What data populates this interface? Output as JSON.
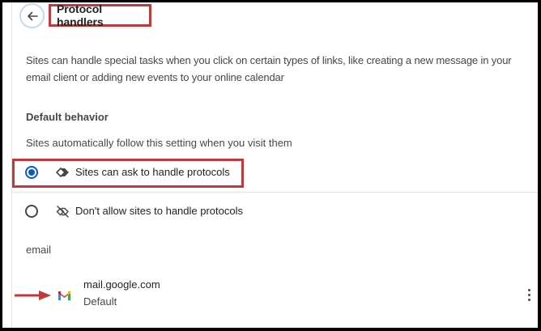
{
  "header": {
    "title": "Protocol handlers"
  },
  "description": "Sites can handle special tasks when you click on certain types of links, like creating a new message in your email client or adding new events to your online calendar",
  "default_behavior": {
    "title": "Default behavior",
    "subtitle": "Sites automatically follow this setting when you visit them",
    "options": [
      {
        "label": "Sites can ask to handle protocols",
        "selected": true,
        "icon": "protocol-handler-icon"
      },
      {
        "label": "Don't allow sites to handle protocols",
        "selected": false,
        "icon": "protocol-handler-off-icon"
      }
    ]
  },
  "handlers": {
    "group_label": "email",
    "items": [
      {
        "site": "mail.google.com",
        "status": "Default",
        "icon": "gmail-icon"
      }
    ]
  },
  "colors": {
    "annotation_red": "#c0393b",
    "accent_blue": "#0b57d0"
  }
}
